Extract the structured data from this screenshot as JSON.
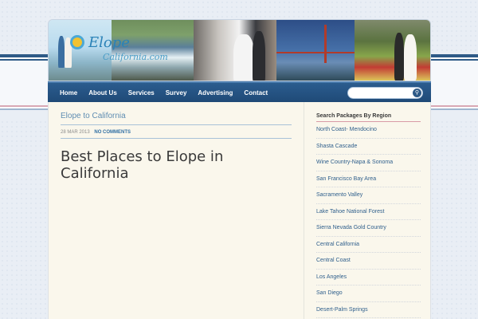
{
  "header": {
    "logo_main": "Elope",
    "logo_sub": "California.com",
    "photos": [
      "beach-couple-photo",
      "coastline-photo",
      "ceremony-photo",
      "golden-gate-photo",
      "garden-couple-photo"
    ]
  },
  "nav": {
    "items": [
      "Home",
      "About Us",
      "Services",
      "Survey",
      "Advertising",
      "Contact"
    ],
    "search_placeholder": "",
    "search_icon": "search-icon"
  },
  "post": {
    "category_title": "Elope to California",
    "date": "28 MAR 2013",
    "comments": "NO COMMENTS",
    "title": "Best Places to Elope in California"
  },
  "sidebar": {
    "heading": "Search Packages By Region",
    "regions": [
      "North Coast- Mendocino",
      "Shasta Cascade",
      "Wine Country-Napa & Sonoma",
      "San Francisco Bay Area",
      "Sacramento Valley",
      "Lake Tahoe National Forest",
      "Sierra Nevada Gold Country",
      "Central California",
      "Central Coast",
      "Los Angeles",
      "San Diego",
      "Desert-Palm Springs"
    ]
  },
  "colors": {
    "nav_bg": "#1f4a77",
    "link": "#2f5f8c",
    "page_bg": "#e9eef5",
    "content_bg": "#faf7ec"
  }
}
